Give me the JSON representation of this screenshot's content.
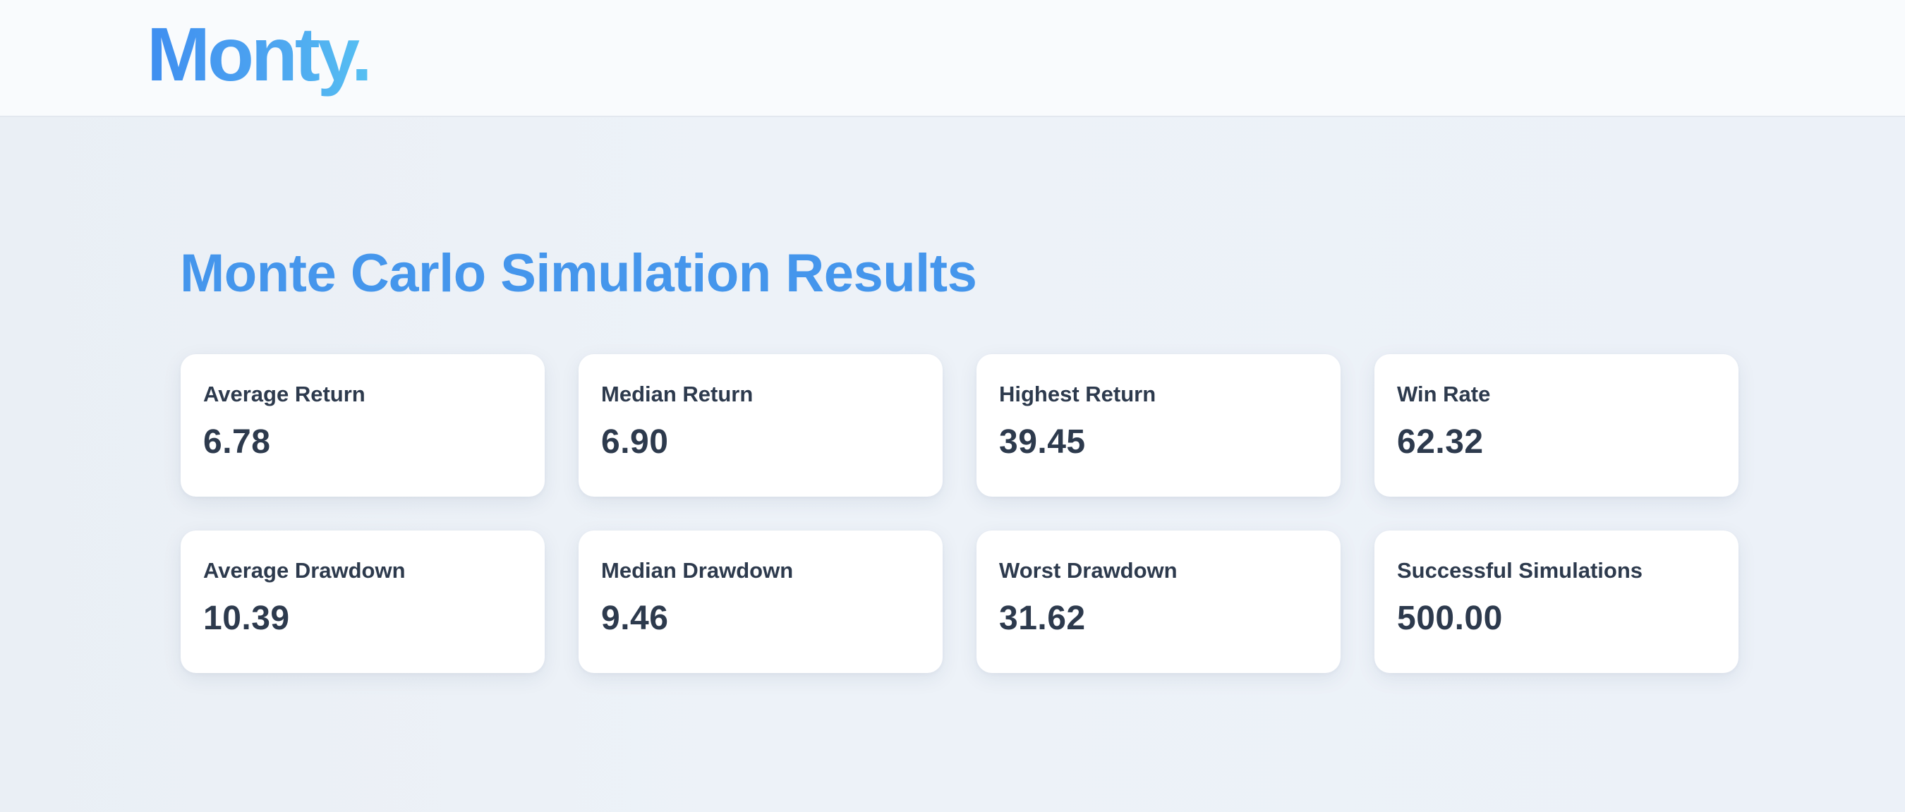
{
  "header": {
    "logo_text": "Monty."
  },
  "main": {
    "title": "Monte Carlo Simulation Results",
    "stats": [
      {
        "label": "Average Return",
        "value": "6.78"
      },
      {
        "label": "Median Return",
        "value": "6.90"
      },
      {
        "label": "Highest Return",
        "value": "39.45"
      },
      {
        "label": "Win Rate",
        "value": "62.32"
      },
      {
        "label": "Average Drawdown",
        "value": "10.39"
      },
      {
        "label": "Median Drawdown",
        "value": "9.46"
      },
      {
        "label": "Worst Drawdown",
        "value": "31.62"
      },
      {
        "label": "Successful Simulations",
        "value": "500.00"
      }
    ]
  },
  "colors": {
    "brand_gradient_start": "#3f8ef0",
    "brand_gradient_end": "#56c0f2",
    "title": "#4596ec",
    "text": "#2d3a4d",
    "background": "#edf2f8",
    "card": "#ffffff"
  }
}
